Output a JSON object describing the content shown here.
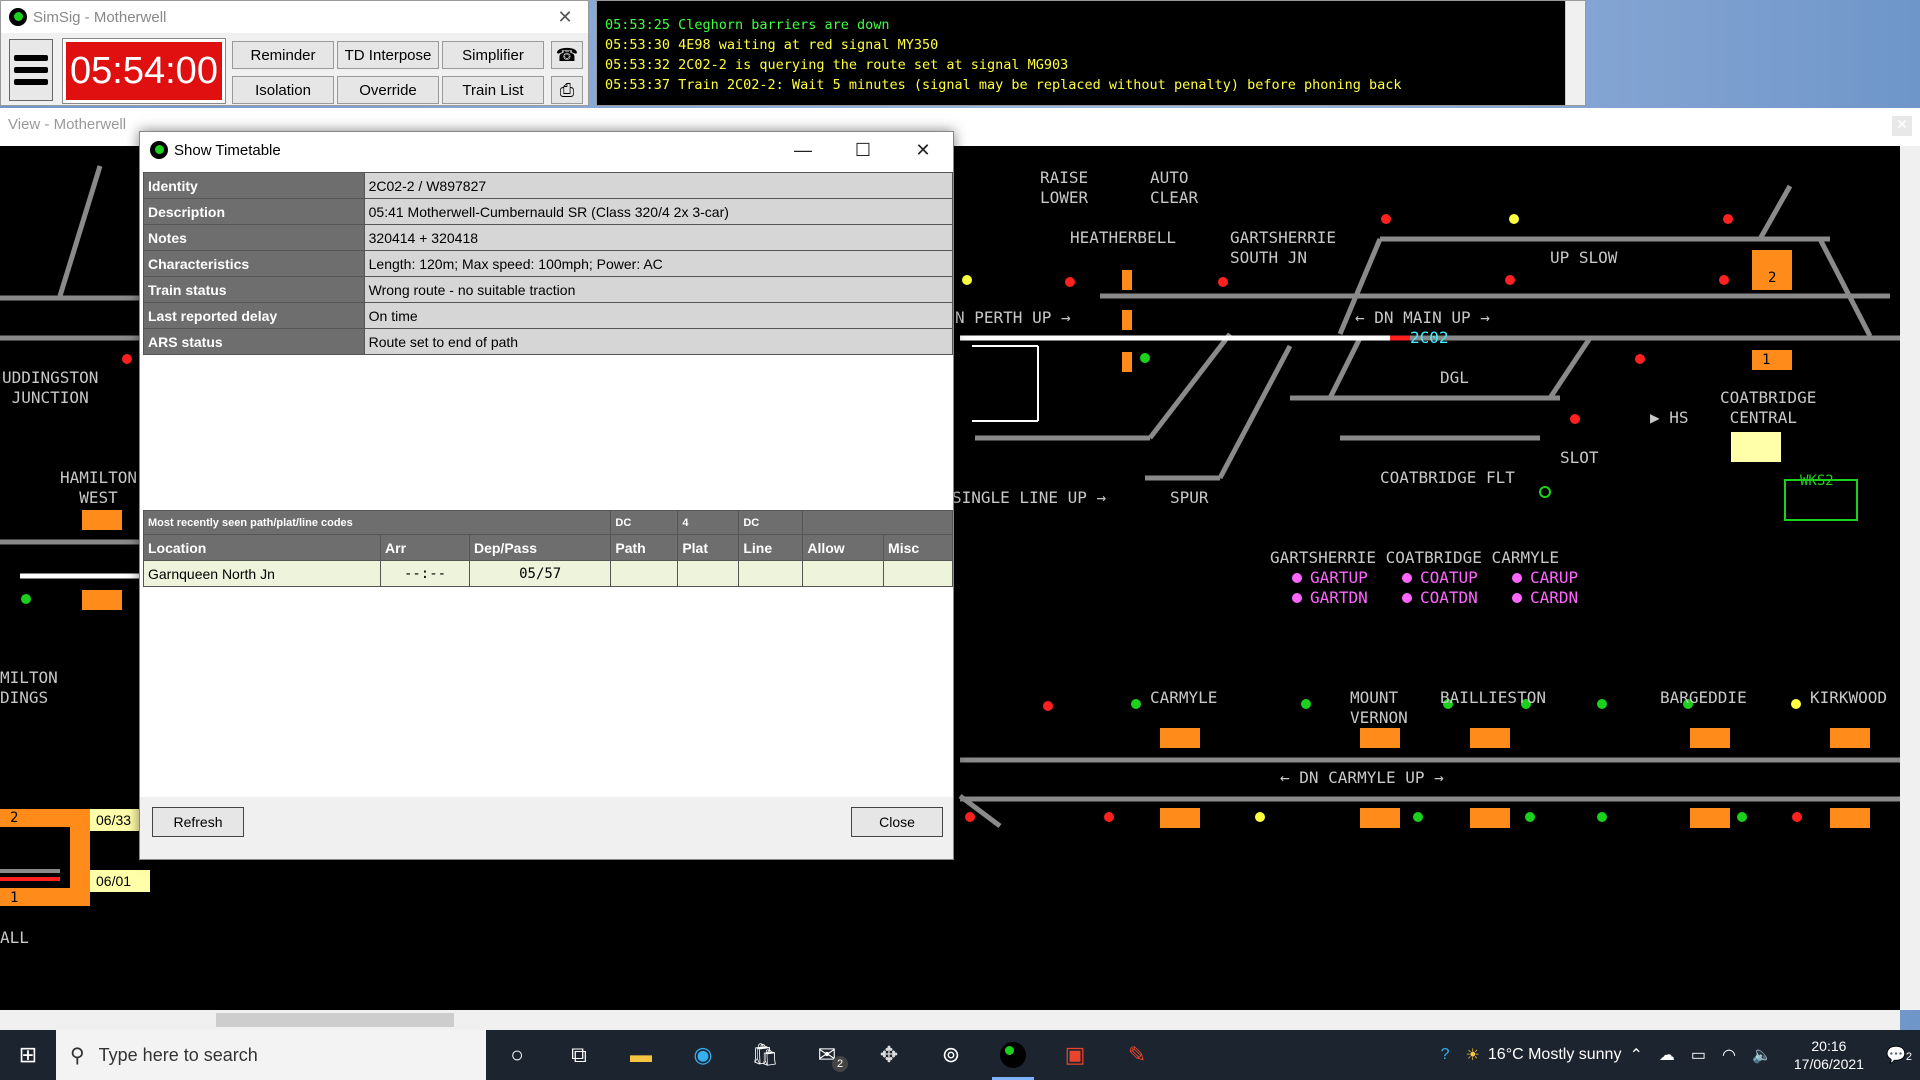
{
  "simsig": {
    "title": "SimSig - Motherwell",
    "clock": "05:54:00",
    "buttons": [
      "Reminder",
      "TD Interpose",
      "Simplifier",
      "Isolation",
      "Override",
      "Train List"
    ]
  },
  "messages": [
    {
      "text": "05:53:25 Cleghorn barriers are down",
      "color": "#40ff40"
    },
    {
      "text": "05:53:30 4E98 waiting at red signal MY350",
      "color": "#ffff40"
    },
    {
      "text": "05:53:32 2C02-2 is querying the route set at signal MG903",
      "color": "#ffff40"
    },
    {
      "text": "05:53:37 Train 2C02-2: Wait 5 minutes (signal may be replaced without penalty) before phoning back",
      "color": "#ffff40"
    }
  ],
  "view": {
    "title": "View - Motherwell",
    "labels": {
      "raise": "RAISE",
      "lower": "LOWER",
      "auto": "AUTO",
      "clear": "CLEAR",
      "heatherbell": "HEATHERBELL",
      "gartsherrie_south": "GARTSHERRIE\nSOUTH JN",
      "up_slow": "UP SLOW",
      "perth_up": "N PERTH UP →",
      "dn_main_up": "← DN MAIN UP →",
      "train_2c02": "2C02",
      "dgl": "DGL",
      "hs": "▶ HS",
      "coatbridge_central": "COATBRIDGE\n CENTRAL",
      "coatbridge_flt": "COATBRIDGE FLT",
      "slot": "SLOT",
      "spur": "SPUR",
      "single_line_up": "SINGLE LINE UP →",
      "wks2": "WKS2",
      "uddingston": "UDDINGSTON\n JUNCTION",
      "hamilton": "HAMILTON\n  WEST",
      "milton": "MILTON\nDINGS",
      "all": "ALL",
      "carmyle": "CARMYLE",
      "mount_vernon": "MOUNT\nVERNON",
      "baillieston": "BAILLIESTON",
      "bargeddie": "BARGEDDIE",
      "kirkwood": "KIRKWOOD",
      "dn_carmyle_up": "← DN CARMYLE UP →",
      "group_heads": "GARTSHERRIE COATBRIDGE CARMYLE",
      "gartup": "GARTUP",
      "gartdn": "GARTDN",
      "coatup": "COATUP",
      "coatdn": "COATDN",
      "carup": "CARUP",
      "cardn": "CARDN",
      "plat_2": "2",
      "plat_1": "1",
      "plat_left_2": "2",
      "plat_left_1": "1",
      "tt_0633": "06/33",
      "tt_0601": "06/01"
    }
  },
  "dialog": {
    "title": "Show Timetable",
    "info": [
      {
        "key": "Identity",
        "value": "2C02-2 / W897827"
      },
      {
        "key": "Description",
        "value": "05:41 Motherwell-Cumbernauld SR (Class 320/4 2x 3-car)"
      },
      {
        "key": "Notes",
        "value": "320414 + 320418"
      },
      {
        "key": "Characteristics",
        "value": "Length: 120m; Max speed: 100mph; Power: AC"
      },
      {
        "key": "Train status",
        "value": "Wrong route - no suitable traction"
      },
      {
        "key": "Last reported delay",
        "value": "On time"
      },
      {
        "key": "ARS status",
        "value": "Route set to end of path"
      }
    ],
    "codes": {
      "caption": "Most recently seen path/plat/line codes",
      "path": "DC",
      "plat": "4",
      "line": "DC"
    },
    "columns": [
      "Location",
      "Arr",
      "Dep/Pass",
      "Path",
      "Plat",
      "Line",
      "Allow",
      "Misc"
    ],
    "rows": [
      {
        "location": "Garnqueen North Jn",
        "arr": "--:--",
        "dep": "05/57",
        "path": "",
        "plat": "",
        "line": "",
        "allow": "",
        "misc": ""
      }
    ],
    "refresh": "Refresh",
    "close": "Close"
  },
  "taskbar": {
    "search_placeholder": "Type here to search",
    "weather": "16°C  Mostly sunny",
    "time": "20:16",
    "date": "17/06/2021",
    "mail_badge": "2",
    "notif_badge": "2"
  }
}
